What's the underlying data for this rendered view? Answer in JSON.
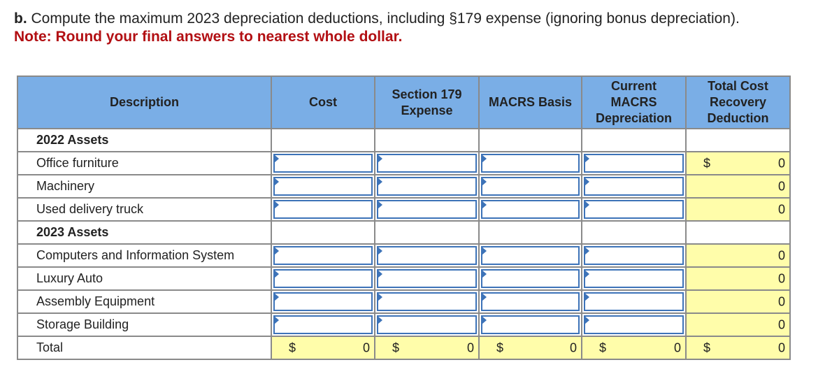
{
  "question": {
    "label": "b.",
    "text": "Compute the maximum 2023 depreciation deductions, including §179 expense (ignoring bonus depreciation).",
    "note": "Note: Round your final answers to nearest whole dollar."
  },
  "table": {
    "headers": [
      "Description",
      "Cost",
      "Section 179\nExpense",
      "MACRS Basis",
      "Current\nMACRS\nDepreciation",
      "Total Cost\nRecovery\nDeduction"
    ],
    "header_lines": {
      "description": [
        "Description"
      ],
      "cost": [
        "Cost"
      ],
      "s179": [
        "Section 179",
        "Expense"
      ],
      "basis": [
        "MACRS Basis"
      ],
      "current": [
        "Current",
        "MACRS",
        "Depreciation"
      ],
      "total": [
        "Total Cost",
        "Recovery",
        "Deduction"
      ]
    },
    "rows": [
      {
        "type": "section",
        "label": "2022 Assets"
      },
      {
        "type": "asset",
        "label": "Office furniture",
        "cost": "",
        "s179": "",
        "basis": "",
        "current": "",
        "total": "0",
        "total_dollar": "$"
      },
      {
        "type": "asset",
        "label": "Machinery",
        "cost": "",
        "s179": "",
        "basis": "",
        "current": "",
        "total": "0",
        "total_dollar": ""
      },
      {
        "type": "asset",
        "label": "Used delivery truck",
        "cost": "",
        "s179": "",
        "basis": "",
        "current": "",
        "total": "0",
        "total_dollar": ""
      },
      {
        "type": "section",
        "label": "2023 Assets"
      },
      {
        "type": "asset",
        "label": "Computers and Information System",
        "cost": "",
        "s179": "",
        "basis": "",
        "current": "",
        "total": "0",
        "total_dollar": ""
      },
      {
        "type": "asset",
        "label": "Luxury Auto",
        "cost": "",
        "s179": "",
        "basis": "",
        "current": "",
        "total": "0",
        "total_dollar": ""
      },
      {
        "type": "asset",
        "label": "Assembly Equipment",
        "cost": "",
        "s179": "",
        "basis": "",
        "current": "",
        "total": "0",
        "total_dollar": ""
      },
      {
        "type": "asset",
        "label": "Storage Building",
        "cost": "",
        "s179": "",
        "basis": "",
        "current": "",
        "total": "0",
        "total_dollar": ""
      }
    ],
    "total_row": {
      "label": "Total",
      "currency": "$",
      "cost": "0",
      "s179": "0",
      "basis": "0",
      "current": "0",
      "total": "0"
    }
  },
  "colors": {
    "header_bg": "#7aaee6",
    "input_border": "#3d73b8",
    "calc_bg": "#fffdaa",
    "note_red": "#b20f13"
  }
}
